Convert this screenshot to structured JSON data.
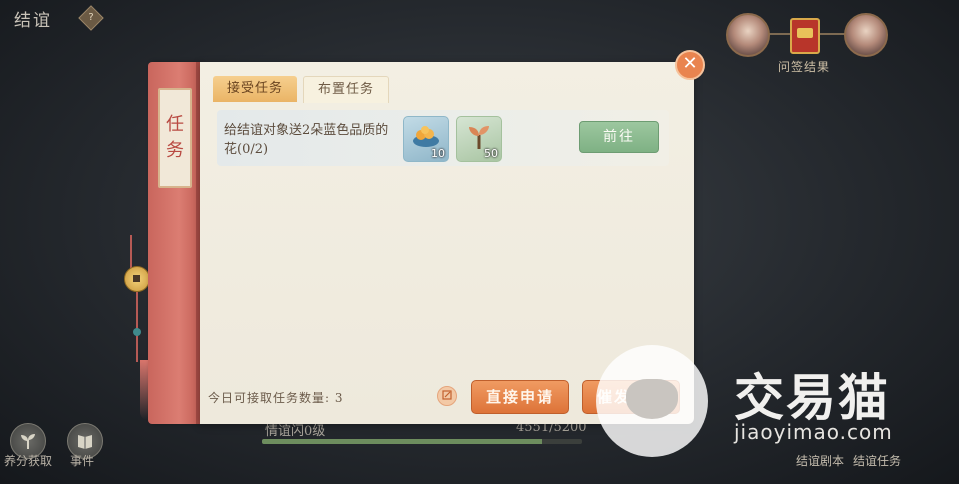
{
  "header": {
    "title": "结谊",
    "help_glyph": "?"
  },
  "top_right": {
    "result_label": "问签结果",
    "left_portrait": "portrait",
    "right_portrait": "portrait"
  },
  "bottom_left": {
    "items": [
      {
        "label": "养分获取",
        "icon": "sprout-icon"
      },
      {
        "label": "事件",
        "icon": "book-icon"
      }
    ]
  },
  "progress": {
    "level_text": "情谊闪0级",
    "exp_text": "4551/5200",
    "exp_fraction": 0.875
  },
  "bottom_right": {
    "left_label": "结谊剧本",
    "right_label": "结谊任务"
  },
  "watermark": {
    "brand": "交易猫",
    "url": "jiaoyimao.com"
  },
  "task_panel": {
    "spine_title": [
      "任",
      "务"
    ],
    "tabs": [
      {
        "label": "接受任务",
        "active": true
      },
      {
        "label": "布置任务",
        "active": false
      }
    ],
    "tasks": [
      {
        "description": "给结谊对象送2朵蓝色品质的花(0/2)",
        "rewards": [
          {
            "icon": "food-basket-icon",
            "count": "10"
          },
          {
            "icon": "sprout-icon",
            "count": "50"
          }
        ],
        "action_label": "前往"
      }
    ],
    "daily_count_text": "今日可接取任务数量: 3",
    "apply_label": "直接申请",
    "publish_label": "催发任务",
    "close_glyph": "✕"
  },
  "colors": {
    "accent_orange": "#dd7338",
    "spine_red": "#db7d72",
    "go_green": "#7fb184"
  }
}
